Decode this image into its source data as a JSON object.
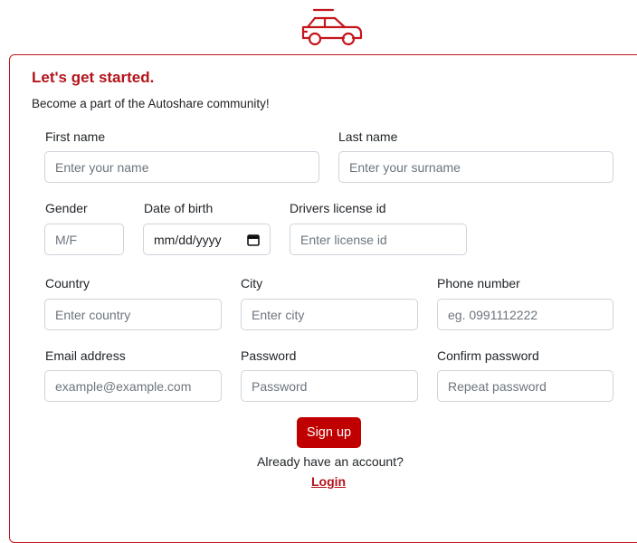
{
  "header": {
    "logo_icon": "car-icon",
    "accent_color": "#c4161c"
  },
  "form": {
    "title": "Let's get started.",
    "subtitle": "Become a part of the Autoshare community!",
    "first_name": {
      "label": "First name",
      "placeholder": "Enter your name"
    },
    "last_name": {
      "label": "Last name",
      "placeholder": "Enter your surname"
    },
    "gender": {
      "label": "Gender",
      "placeholder": "M/F"
    },
    "dob": {
      "label": "Date of birth",
      "value": "mm/dd/yyyy",
      "icon": "calendar-icon"
    },
    "license": {
      "label": "Drivers license id",
      "placeholder": "Enter license id"
    },
    "country": {
      "label": "Country",
      "placeholder": "Enter country"
    },
    "city": {
      "label": "City",
      "placeholder": "Enter city"
    },
    "phone": {
      "label": "Phone number",
      "placeholder": "eg. 0991112222"
    },
    "email": {
      "label": "Email address",
      "placeholder": "example@example.com"
    },
    "password": {
      "label": "Password",
      "placeholder": "Password"
    },
    "confirm": {
      "label": "Confirm password",
      "placeholder": "Repeat password"
    },
    "signup_label": "Sign up",
    "already_text": "Already have an account?",
    "login_label": "Login"
  }
}
